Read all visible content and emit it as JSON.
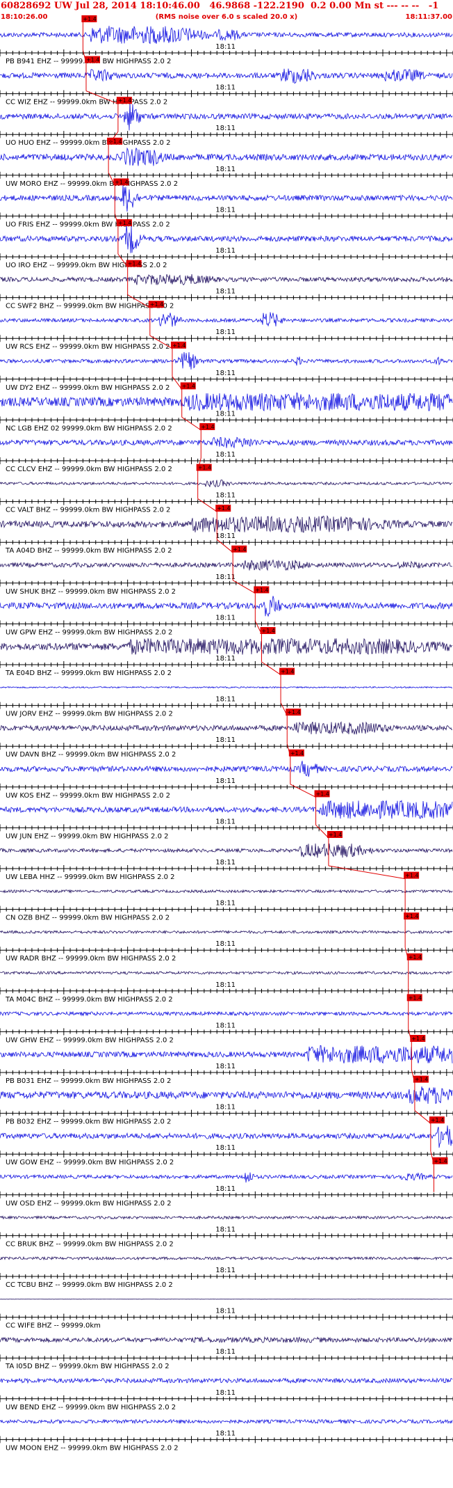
{
  "header": {
    "title": "60828692 UW Jul 28, 2014 18:10:46.00   46.9868 -122.2190  0.2 0.00 Mn st --- -- --   -1",
    "start_time": "18:10:26.00",
    "note": "(RMS noise over 6.0 s scaled 20.0 x)",
    "end_time": "18:11:37.00"
  },
  "colors": {
    "header": "#e00000",
    "pick": "#e00000",
    "blue": "#1010e0",
    "dark": "#201060",
    "axis": "#000000"
  },
  "chart_data": {
    "type": "seismogram",
    "x_range_seconds": [
      0,
      71
    ],
    "tick_label": "18:11",
    "tick_label_time_s": 34,
    "pick_label": "+1.4",
    "traces": [
      {
        "label": "PB B941 EHZ -- 99999.0km BW  HIGHPASS  2.0  2",
        "color": "blue",
        "pick_s": 13.0,
        "event_s": [
          [
            14,
            14,
            1.0
          ],
          [
            22,
            4,
            0.8
          ],
          [
            34,
            3,
            0.6
          ]
        ],
        "noise": 0.25
      },
      {
        "label": "CC WIZ EHZ -- 99999.0km BW  HIGHPASS  2.0  2",
        "color": "blue",
        "pick_s": 13.5,
        "event_s": [
          [
            14,
            3,
            0.7
          ],
          [
            44,
            4,
            0.9
          ],
          [
            60,
            5,
            0.7
          ]
        ],
        "noise": 0.3
      },
      {
        "label": "UO HUO EHZ -- 99999.0km BW  HIGHPASS  2.0  2",
        "color": "blue",
        "pick_s": 18.5,
        "event_s": [
          [
            19.5,
            1.5,
            1.6
          ]
        ],
        "noise": 0.3
      },
      {
        "label": "UW MORO EHZ -- 99999.0km BW  HIGHPASS  2.0  2",
        "color": "blue",
        "pick_s": 17.0,
        "event_s": [
          [
            19,
            5,
            1.0
          ]
        ],
        "noise": 0.35
      },
      {
        "label": "UO FRIS EHZ -- 99999.0km BW  HIGHPASS  2.0  2",
        "color": "blue",
        "pick_s": 18.0,
        "event_s": [
          [
            19,
            1.5,
            1.6
          ]
        ],
        "noise": 0.3
      },
      {
        "label": "UO IRO EHZ -- 99999.0km BW  HIGHPASS  2.0  2",
        "color": "blue",
        "pick_s": 18.5,
        "event_s": [
          [
            19.5,
            1.5,
            1.6
          ]
        ],
        "noise": 0.3
      },
      {
        "label": "CC SWF2 BHZ -- 99999.0km BW  HIGHPASS  2.0  2",
        "color": "dark",
        "pick_s": 20.0,
        "event_s": [
          [
            21,
            10,
            0.6
          ]
        ],
        "noise": 0.25
      },
      {
        "label": "UW RCS EHZ -- 99999.0km BW  HIGHPASS  2.0  2",
        "color": "blue",
        "pick_s": 23.5,
        "event_s": [
          [
            25,
            2,
            0.9
          ],
          [
            41,
            2,
            0.9
          ]
        ],
        "noise": 0.2
      },
      {
        "label": "UW DY2 EHZ -- 99999.0km BW  HIGHPASS  2.0  2",
        "color": "blue",
        "pick_s": 27.0,
        "event_s": [
          [
            28,
            2,
            1.0
          ],
          [
            46,
            1,
            0.5
          ],
          [
            68,
            1,
            0.5
          ]
        ],
        "noise": 0.2
      },
      {
        "label": "NC LGB EHZ 02 99999.0km BW  HIGHPASS  2.0  2",
        "color": "blue",
        "pick_s": 28.5,
        "event_s": [
          [
            29,
            42,
            1.0
          ]
        ],
        "noise": 0.5
      },
      {
        "label": "CC CLCV EHZ -- 99999.0km BW  HIGHPASS  2.0  2",
        "color": "blue",
        "pick_s": 31.5,
        "event_s": [
          [
            33,
            6,
            0.6
          ]
        ],
        "noise": 0.3
      },
      {
        "label": "CC VALT BHZ -- 99999.0km BW  HIGHPASS  2.0  2",
        "color": "dark",
        "pick_s": 31.0,
        "event_s": [
          [
            32,
            3,
            0.4
          ]
        ],
        "noise": 0.15
      },
      {
        "label": "TA A04D BHZ -- 99999.0km BW  HIGHPASS  2.0  2",
        "color": "dark",
        "pick_s": 34.0,
        "event_s": [
          [
            30,
            25,
            0.9
          ]
        ],
        "noise": 0.35
      },
      {
        "label": "UW SHUK BHZ -- 99999.0km BW  HIGHPASS  2.0  2",
        "color": "dark",
        "pick_s": 36.5,
        "event_s": [
          [
            38,
            8,
            0.6
          ],
          [
            62,
            4,
            0.4
          ]
        ],
        "noise": 0.25
      },
      {
        "label": "UW GPW EHZ -- 99999.0km BW  HIGHPASS  2.0  2",
        "color": "blue",
        "pick_s": 40.0,
        "event_s": [
          [
            41,
            2,
            1.2
          ]
        ],
        "noise": 0.35
      },
      {
        "label": "TA E04D BHZ -- 99999.0km BW  HIGHPASS  2.0  2",
        "color": "dark",
        "pick_s": 41.0,
        "event_s": [
          [
            20,
            40,
            0.9
          ]
        ],
        "noise": 0.4
      },
      {
        "label": "UW JORV EHZ -- 99999.0km BW  HIGHPASS  2.0  2",
        "color": "blue",
        "pick_s": 44.0,
        "event_s": [],
        "noise": 0.08
      },
      {
        "label": "UW DAVN BHZ -- 99999.0km BW  HIGHPASS  2.0  2",
        "color": "dark",
        "pick_s": 45.0,
        "event_s": [
          [
            46,
            12,
            0.7
          ]
        ],
        "noise": 0.3
      },
      {
        "label": "UW KOS EHZ -- 99999.0km BW  HIGHPASS  2.0  2",
        "color": "blue",
        "pick_s": 45.5,
        "event_s": [
          [
            47,
            2,
            0.9
          ]
        ],
        "noise": 0.3
      },
      {
        "label": "UW JUN EHZ -- 99999.0km BW  HIGHPASS  2.0  2",
        "color": "blue",
        "pick_s": 49.5,
        "event_s": [
          [
            50,
            20,
            1.0
          ]
        ],
        "noise": 0.3
      },
      {
        "label": "UW LEBA HHZ -- 99999.0km BW  HIGHPASS  2.0  2",
        "color": "dark",
        "pick_s": 51.5,
        "event_s": [
          [
            47,
            8,
            0.8
          ]
        ],
        "noise": 0.2
      },
      {
        "label": "CN OZB BHZ -- 99999.0km BW  HIGHPASS  2.0  2",
        "color": "dark",
        "pick_s": 63.5,
        "event_s": [],
        "noise": 0.15
      },
      {
        "label": "UW RADR BHZ -- 99999.0km BW  HIGHPASS  2.0  2",
        "color": "dark",
        "pick_s": 63.5,
        "event_s": [],
        "noise": 0.15
      },
      {
        "label": "TA M04C BHZ -- 99999.0km BW  HIGHPASS  2.0  2",
        "color": "dark",
        "pick_s": 64.0,
        "event_s": [],
        "noise": 0.15
      },
      {
        "label": "UW GHW EHZ -- 99999.0km BW  HIGHPASS  2.0  2",
        "color": "blue",
        "pick_s": 64.0,
        "event_s": [],
        "noise": 0.2
      },
      {
        "label": "PB B031 EHZ -- 99999.0km BW  HIGHPASS  2.0  2",
        "color": "blue",
        "pick_s": 64.5,
        "event_s": [
          [
            48,
            23,
            1.0
          ]
        ],
        "noise": 0.3
      },
      {
        "label": "PB B032 EHZ -- 99999.0km BW  HIGHPASS  2.0  2",
        "color": "blue",
        "pick_s": 65.0,
        "event_s": [
          [
            64,
            7,
            1.0
          ]
        ],
        "noise": 0.4
      },
      {
        "label": "UW GOW EHZ -- 99999.0km BW  HIGHPASS  2.0  2",
        "color": "blue",
        "pick_s": 67.5,
        "event_s": [
          [
            68.5,
            2,
            1.3
          ]
        ],
        "noise": 0.3
      },
      {
        "label": "UW OSD EHZ -- 99999.0km BW  HIGHPASS  2.0  2",
        "color": "blue",
        "pick_s": 68.0,
        "event_s": [
          [
            38,
            1,
            0.8
          ],
          [
            62,
            4,
            0.4
          ]
        ],
        "noise": 0.2
      },
      {
        "label": "CC BRUK BHZ -- 99999.0km BW  HIGHPASS  2.0  2",
        "color": "dark",
        "pick_s": null,
        "event_s": [],
        "noise": 0.15
      },
      {
        "label": "CC TCBU BHZ -- 99999.0km BW  HIGHPASS  2.0  2",
        "color": "dark",
        "pick_s": null,
        "event_s": [],
        "noise": 0.15
      },
      {
        "label": "CC WIFE BHZ -- 99999.0km",
        "color": "dark",
        "pick_s": null,
        "event_s": [],
        "noise": 0.02
      },
      {
        "label": "TA I05D BHZ -- 99999.0km BW  HIGHPASS  2.0  2",
        "color": "dark",
        "pick_s": null,
        "event_s": [
          [
            30,
            20,
            0.3
          ]
        ],
        "noise": 0.25
      },
      {
        "label": "UW BEND EHZ -- 99999.0km BW  HIGHPASS  2.0  2",
        "color": "blue",
        "pick_s": null,
        "event_s": [],
        "noise": 0.25
      },
      {
        "label": "UW MOON EHZ -- 99999.0km BW  HIGHPASS  2.0  2",
        "color": "blue",
        "pick_s": null,
        "event_s": [],
        "noise": 0.2
      }
    ]
  }
}
